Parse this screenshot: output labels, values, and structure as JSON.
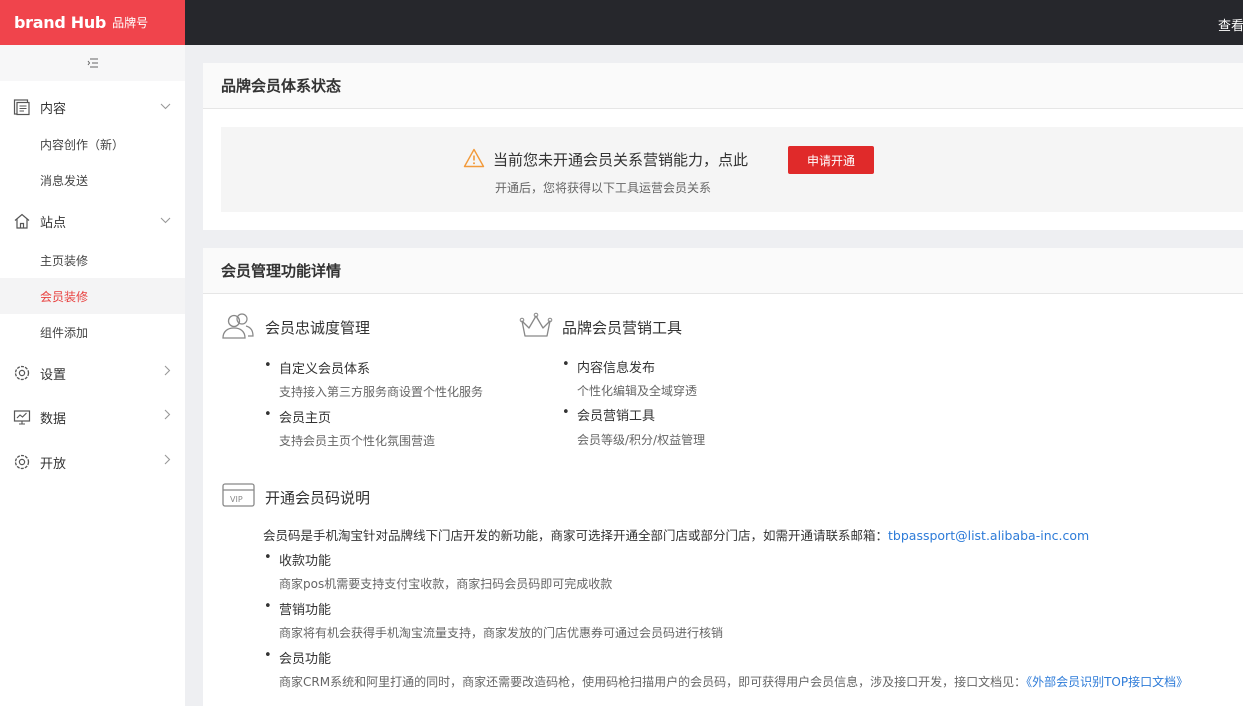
{
  "topbar": {
    "logo": "brand Hub",
    "logo_sub": "品牌号",
    "right_text": "查看介"
  },
  "sidebar": {
    "collapse_icon": "≡",
    "groups": [
      {
        "label": "内容",
        "icon": "document-icon",
        "subs": [
          "内容创作（新）",
          "消息发送"
        ]
      },
      {
        "label": "站点",
        "icon": "home-icon",
        "subs": [
          "主页装修",
          "会员装修",
          "组件添加"
        ]
      },
      {
        "label": "设置",
        "icon": "gear-icon",
        "subs": []
      },
      {
        "label": "数据",
        "icon": "monitor-chart-icon",
        "subs": []
      },
      {
        "label": "开放",
        "icon": "gear-icon",
        "subs": []
      }
    ],
    "active_sub": "会员装修"
  },
  "status_panel": {
    "title": "品牌会员体系状态",
    "notice_text": "当前您未开通会员关系营销能力，点此",
    "notice_sub": "开通后，您将获得以下工具运营会员关系",
    "apply_button": "申请开通"
  },
  "detail_panel": {
    "title": "会员管理功能详情",
    "loyalty": {
      "title": "会员忠诚度管理",
      "items": [
        {
          "label": "自定义会员体系",
          "desc": "支持接入第三方服务商设置个性化服务"
        },
        {
          "label": "会员主页",
          "desc": "支持会员主页个性化氛围营造"
        }
      ]
    },
    "marketing": {
      "title": "品牌会员营销工具",
      "items": [
        {
          "label": "内容信息发布",
          "desc": "个性化编辑及全域穿透"
        },
        {
          "label": "会员营销工具",
          "desc": "会员等级/积分/权益管理"
        }
      ]
    },
    "vip": {
      "title": "开通会员码说明",
      "icon_label": "VIP",
      "intro": "会员码是手机淘宝针对品牌线下门店开发的新功能，商家可选择开通全部门店或部分门店，如需开通请联系邮箱：",
      "email": "tbpassport@list.alibaba-inc.com",
      "items": [
        {
          "label": "收款功能",
          "desc": "商家pos机需要支持支付宝收款，商家扫码会员码即可完成收款"
        },
        {
          "label": "营销功能",
          "desc": "商家将有机会获得手机淘宝流量支持，商家发放的门店优惠券可通过会员码进行核销"
        },
        {
          "label": "会员功能",
          "desc": "商家CRM系统和阿里打通的同时，商家还需要改造码枪，使用码枪扫描用户的会员码，即可获得用户会员信息，涉及接口开发，接口文档见：",
          "link": "《外部会员识别TOP接口文档》"
        }
      ]
    }
  },
  "colors": {
    "brand_red": "#f0444c",
    "topbar_dark": "#26272c",
    "button_red": "#e02a2a",
    "active_text": "#e8413f",
    "link_blue": "#2d7bd8",
    "warning_orange": "#f29a3b"
  }
}
